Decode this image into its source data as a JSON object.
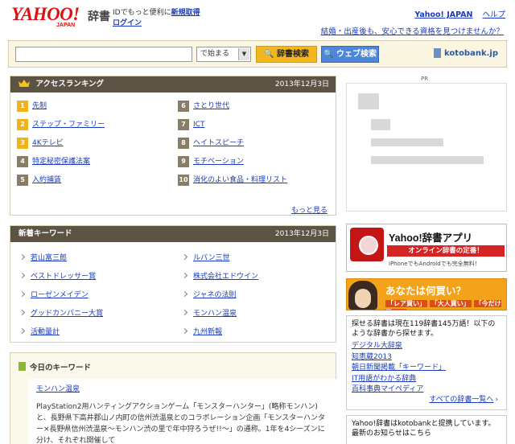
{
  "header": {
    "logo": "YAHOO!",
    "logo_sub": "JAPAN",
    "title": "辞書",
    "promo_text": "IDでもっと便利に",
    "register_link": "新規取得",
    "login_link": "ログイン",
    "top_links": [
      "Yahoo! JAPAN",
      "ヘルプ"
    ],
    "ad_text": "結婚・出産後も、安心できる資格を見つけませんか？"
  },
  "search": {
    "input_value": "",
    "match_mode": "で始まる",
    "dict_search_label": "辞書検索",
    "web_search_label": "ウェブ検索",
    "kotobank_label": "kotobank.jp"
  },
  "ranking": {
    "title": "アクセスランキング",
    "date": "2013年12月3日",
    "items": [
      {
        "rank": "1",
        "label": "先制"
      },
      {
        "rank": "2",
        "label": "ステップ・ファミリー"
      },
      {
        "rank": "3",
        "label": "4Kテレビ"
      },
      {
        "rank": "4",
        "label": "特定秘密保護法案"
      },
      {
        "rank": "5",
        "label": "入約捕賃"
      },
      {
        "rank": "6",
        "label": "さとり世代"
      },
      {
        "rank": "7",
        "label": "ICT"
      },
      {
        "rank": "8",
        "label": "ヘイトスピーチ"
      },
      {
        "rank": "9",
        "label": "モチベーション"
      },
      {
        "rank": "10",
        "label": "消化のよい食品・料理リスト"
      }
    ],
    "more_label": "もっと見る"
  },
  "new_keywords": {
    "title": "新着キーワード",
    "date": "2013年12月3日",
    "items": [
      "若山富三郎",
      "ベストドレッサー賞",
      "ローゼンメイデン",
      "グッドカンパニー大賞",
      "活動量計",
      "ルパン三世",
      "株式会社エドウイン",
      "ジャネの法則",
      "モンハン温泉",
      "九州新報"
    ]
  },
  "today_keyword": {
    "title": "今日のキーワード",
    "word": "モンハン温泉",
    "body": "PlayStation2用ハンティングアクションゲーム「モンスターハンター」(略称モンハン)と、長野県下高井郡山ノ内町の信州渋温泉とのコラボレーション企画「モンスターハンター×長野県信州渋温泉～モンハン渋の里で年中狩ろうぜ!!～」の通称。1年を4シーズンに分け、それぞれ開催して"
  },
  "right": {
    "ad_label": "PR",
    "app_banner": {
      "title": "Yahoo!辞書アプリ",
      "red_text": "オンライン辞書の定番！",
      "note": "iPhoneでもAndroidでも完全無料！"
    },
    "buy_banner": {
      "title": "あなたは何買い？",
      "tags": [
        "「レア買い」",
        "「大人買い」",
        "「今だけ買い」"
      ]
    },
    "dict_box": {
      "intro": "探せる辞書は現在119辞書145万語！以下のような辞書から探せます。",
      "dicts": [
        "デジタル大辞泉",
        "知恵蔵2013",
        "朝日新聞掲載「キーワード」",
        "IT用語がわかる辞典",
        "百科事典マイペディア"
      ],
      "all_label": "すべての辞書一覧へ",
      "all_arrow": "›"
    },
    "kotobank_box": "Yahoo!辞書はkotobankと提携しています。最新のお知らせはこちら"
  }
}
